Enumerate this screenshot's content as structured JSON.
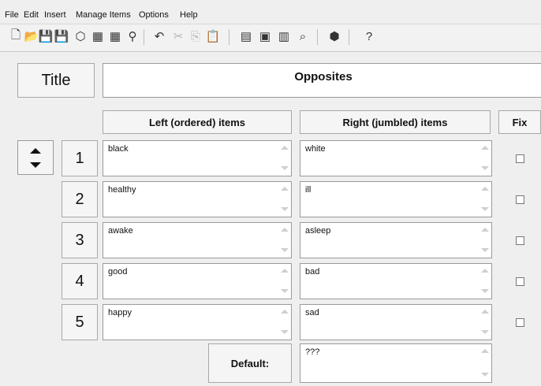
{
  "menu": [
    "File",
    "Edit",
    "Insert",
    "Manage Items",
    "Options",
    "Help"
  ],
  "toolbar": [
    {
      "icon": "new-icon",
      "glyph": "🗋",
      "state": "normal"
    },
    {
      "icon": "open-icon",
      "glyph": "📂",
      "state": "normal"
    },
    {
      "icon": "save-icon",
      "glyph": "💾",
      "state": "normal"
    },
    {
      "icon": "save-as-icon",
      "glyph": "💾",
      "state": "normal"
    },
    {
      "icon": "eraser-icon",
      "glyph": "⬡",
      "state": "normal"
    },
    {
      "icon": "view-icon",
      "glyph": "▦",
      "state": "normal"
    },
    {
      "icon": "view-alt-icon",
      "glyph": "▦",
      "state": "normal"
    },
    {
      "icon": "pin-icon",
      "glyph": "⚲",
      "state": "normal"
    },
    {
      "icon": "undo-icon",
      "glyph": "↶",
      "state": "normal"
    },
    {
      "icon": "cut-icon",
      "glyph": "✂",
      "state": "disabled"
    },
    {
      "icon": "copy-icon",
      "glyph": "⎘",
      "state": "disabled"
    },
    {
      "icon": "paste-icon",
      "glyph": "📋",
      "state": "disabled"
    },
    {
      "icon": "web-page-icon",
      "glyph": "▤",
      "state": "normal"
    },
    {
      "icon": "export-icon",
      "glyph": "▣",
      "state": "normal"
    },
    {
      "icon": "data-icon",
      "glyph": "▥",
      "state": "normal"
    },
    {
      "icon": "search-icon",
      "glyph": "⌕",
      "state": "normal"
    },
    {
      "icon": "shield-icon",
      "glyph": "⬢",
      "state": "normal"
    },
    {
      "icon": "help-icon",
      "glyph": "?",
      "state": "normal"
    }
  ],
  "title": {
    "label": "Title",
    "value": "Opposites"
  },
  "headers": {
    "left": "Left (ordered) items",
    "right": "Right (jumbled) items",
    "fix": "Fix"
  },
  "rows": [
    {
      "num": "1",
      "left": "black",
      "right": "white",
      "fix": false
    },
    {
      "num": "2",
      "left": "healthy",
      "right": "ill",
      "fix": false
    },
    {
      "num": "3",
      "left": "awake",
      "right": "asleep",
      "fix": false
    },
    {
      "num": "4",
      "left": "good",
      "right": "bad",
      "fix": false
    },
    {
      "num": "5",
      "left": "happy",
      "right": "sad",
      "fix": false
    }
  ],
  "default": {
    "label": "Default:",
    "value": "???"
  }
}
